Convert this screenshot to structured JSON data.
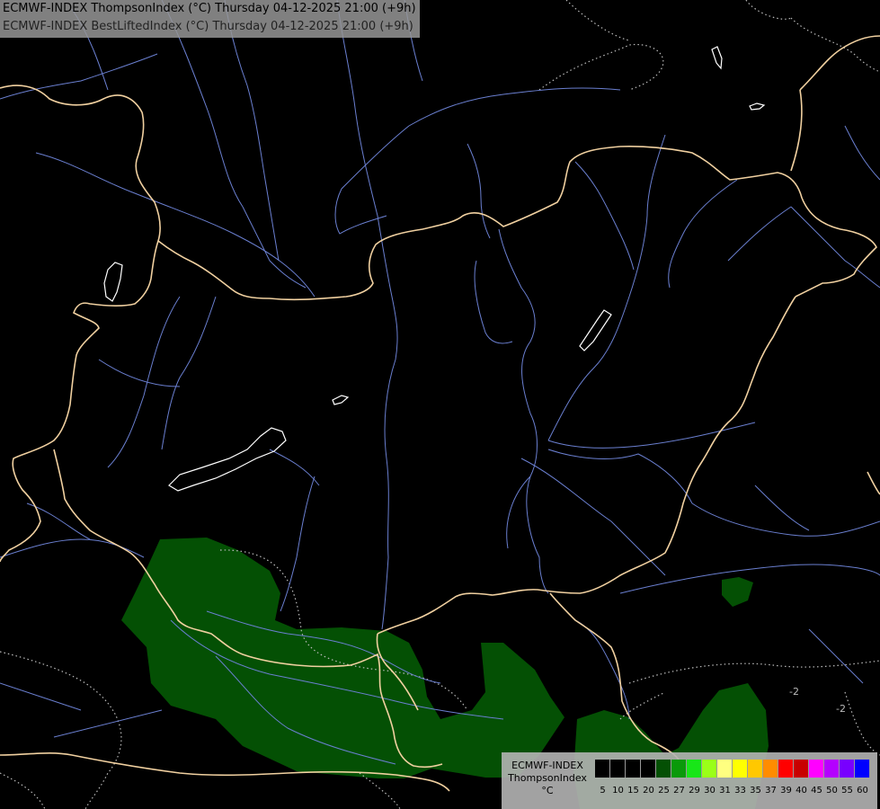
{
  "title": {
    "line1": "ECMWF-INDEX ThompsonIndex (°C) Thursday 04-12-2025 21:00 (+9h)",
    "line2": "ECMWF-INDEX BestLiftedIndex (°C) Thursday 04-12-2025 21:00 (+9h)"
  },
  "map": {
    "background": "#000000",
    "colors": {
      "border": "#f0d0a0",
      "river": "#6a7fd0",
      "lake": "#ffffff",
      "shading": "#045004",
      "contour": "#bbbbbb"
    },
    "contour_labels": [
      "-2",
      "-2"
    ]
  },
  "legend": {
    "model": "ECMWF-INDEX",
    "variable": "ThompsonIndex",
    "unit": "°C",
    "bins": [
      {
        "label": "5",
        "color": "#000000"
      },
      {
        "label": "10",
        "color": "#000000"
      },
      {
        "label": "15",
        "color": "#000000"
      },
      {
        "label": "20",
        "color": "#000000"
      },
      {
        "label": "25",
        "color": "#045004"
      },
      {
        "label": "27",
        "color": "#0a9a0a"
      },
      {
        "label": "29",
        "color": "#18e618"
      },
      {
        "label": "30",
        "color": "#9aff18"
      },
      {
        "label": "31",
        "color": "#ffff80"
      },
      {
        "label": "33",
        "color": "#ffff00"
      },
      {
        "label": "35",
        "color": "#ffc800"
      },
      {
        "label": "37",
        "color": "#ff8c00"
      },
      {
        "label": "39",
        "color": "#ff0000"
      },
      {
        "label": "40",
        "color": "#c80000"
      },
      {
        "label": "45",
        "color": "#ff00ff"
      },
      {
        "label": "50",
        "color": "#b400ff"
      },
      {
        "label": "55",
        "color": "#7800ff"
      },
      {
        "label": "60",
        "color": "#0000ff"
      }
    ]
  }
}
